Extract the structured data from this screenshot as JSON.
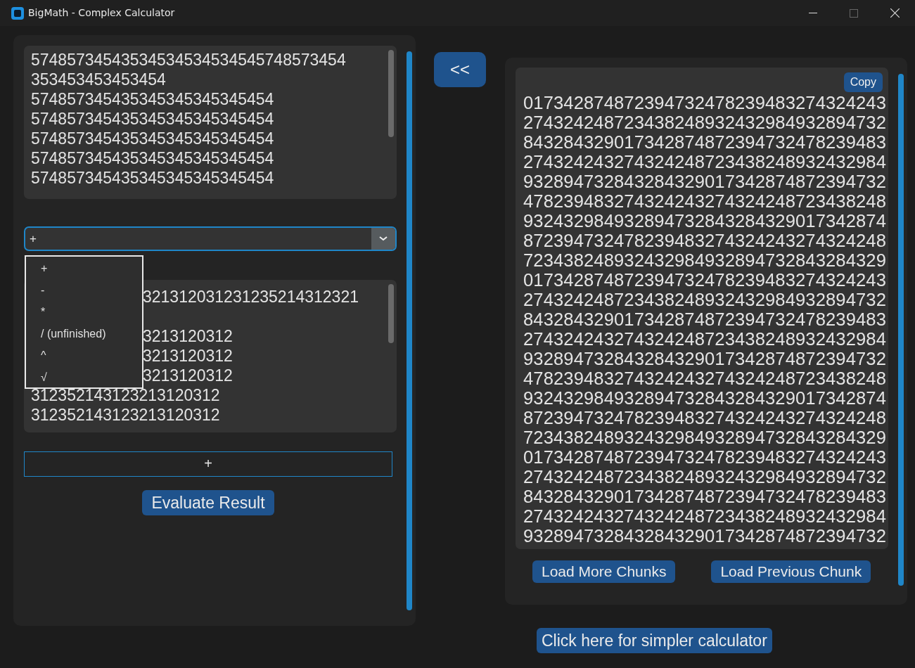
{
  "window": {
    "title": "BigMath - Complex Calculator"
  },
  "first_number": {
    "lines": [
      "57485734543534534534534545748573454",
      "353453453453454",
      "574857345435345345345345454",
      "574857345435345345345345454",
      "574857345435345345345345454",
      "574857345435345345345345454",
      "574857345435345345345345454"
    ]
  },
  "operation_select": {
    "value": "+",
    "expanded": true,
    "options": [
      {
        "label": "+"
      },
      {
        "label": "-"
      },
      {
        "label": "*"
      },
      {
        "label": "/ (unfinished)"
      },
      {
        "label": "^"
      },
      {
        "label": "√"
      }
    ]
  },
  "second_number": {
    "lines": [
      {
        "text": "321312031231235214312321",
        "kind": "partial"
      },
      {
        "text": "3213120312",
        "kind": "partial"
      },
      {
        "text": "3213120312",
        "kind": "partial"
      },
      {
        "text": "3213120312",
        "kind": "partial"
      },
      {
        "text": "312352143123213120312",
        "kind": "full"
      },
      {
        "text": "312352143123213120312",
        "kind": "full"
      }
    ]
  },
  "operator_display": "+",
  "evaluate_button": "Evaluate Result",
  "back_button": "<<",
  "result": {
    "copy_button": "Copy",
    "lines": [
      "017342874872394732478239483274324243",
      "274324248723438248932432984932894732",
      "843284329017342874872394732478239483",
      "274324243274324248723438248932432984",
      "932894732843284329017342874872394732",
      "478239483274324243274324248723438248",
      "932432984932894732843284329017342874",
      "872394732478239483274324243274324248",
      "723438248932432984932894732843284329",
      "017342874872394732478239483274324243",
      "274324248723438248932432984932894732",
      "843284329017342874872394732478239483",
      "274324243274324248723438248932432984",
      "932894732843284329017342874872394732",
      "478239483274324243274324248723438248",
      "932432984932894732843284329017342874",
      "872394732478239483274324243274324248",
      "723438248932432984932894732843284329",
      "017342874872394732478239483274324243",
      "274324248723438248932432984932894732",
      "843284329017342874872394732478239483",
      "274324243274324248723438248932432984",
      "932894732843284329017342874872394732"
    ]
  },
  "chunk_buttons": [
    "Load More Chunks",
    "Load Previous Chunk"
  ],
  "simpler_link": "Click here for simpler calculator"
}
